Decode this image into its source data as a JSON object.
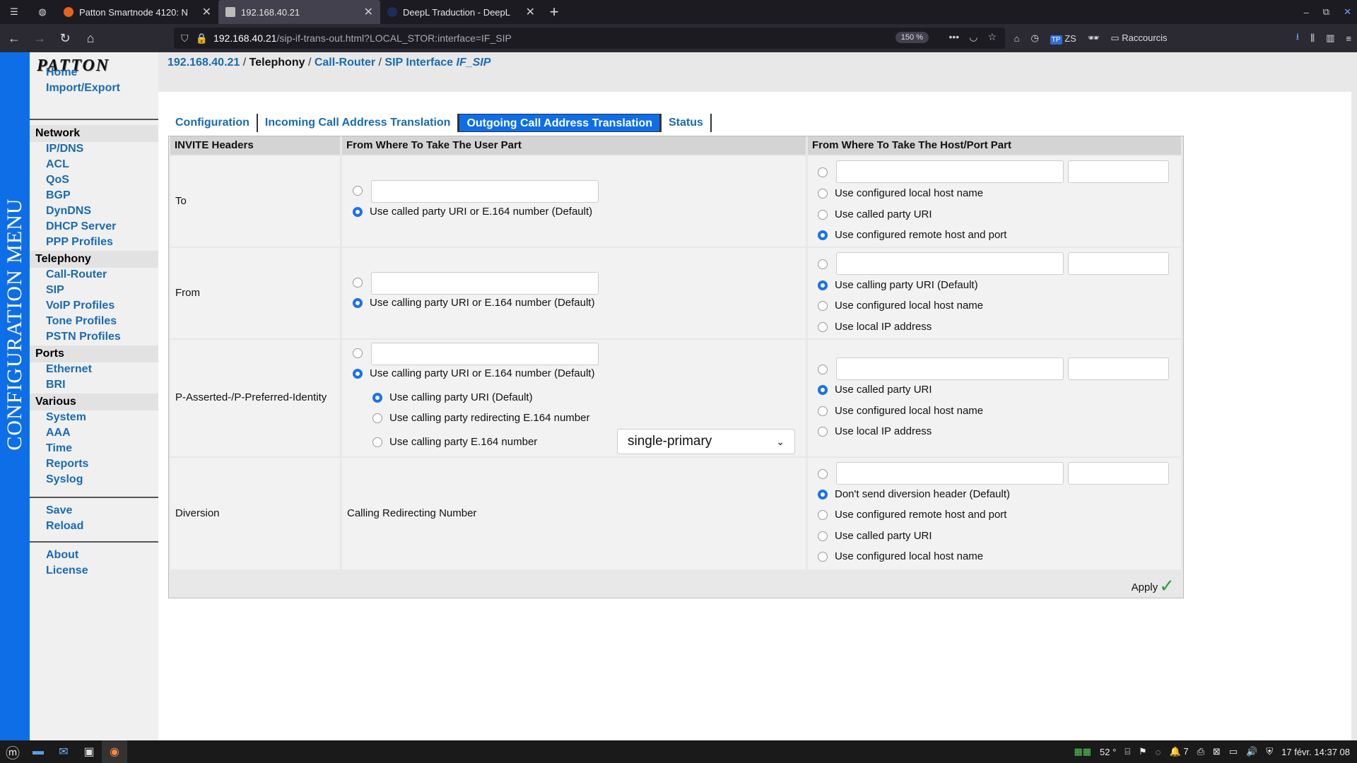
{
  "browser": {
    "tabs": [
      {
        "label": "Patton Smartnode 4120: N",
        "fav_color": "#e8641c"
      },
      {
        "label": "192.168.40.21",
        "fav_color": "#bbbbbb"
      },
      {
        "label": "DeepL Traduction - DeepL",
        "fav_color": "#1b2e5a"
      }
    ],
    "url_host": "192.168.40.21",
    "url_path": "/sip-if-trans-out.html?LOCAL_STOR:interface=IF_SIP",
    "zoom": "150 %",
    "toolbar_profile": "ZS",
    "bookmarks_label": "Raccourcis"
  },
  "side_banner": "CONFIGURATION MENU",
  "logo": "PATTON",
  "menu": {
    "top": [
      "Home",
      "Import/Export"
    ],
    "network_header": "Network",
    "network": [
      "IP/DNS",
      "ACL",
      "QoS",
      "BGP",
      "DynDNS",
      "DHCP Server",
      "PPP Profiles"
    ],
    "telephony_header": "Telephony",
    "telephony": [
      "Call-Router",
      "SIP",
      "VoIP Profiles",
      "Tone Profiles",
      "PSTN Profiles"
    ],
    "ports_header": "Ports",
    "ports": [
      "Ethernet",
      "BRI"
    ],
    "various_header": "Various",
    "various": [
      "System",
      "AAA",
      "Time",
      "Reports",
      "Syslog"
    ],
    "actions": [
      "Save",
      "Reload"
    ],
    "info": [
      "About",
      "License"
    ]
  },
  "breadcrumb": {
    "host": "192.168.40.21",
    "sep1": " / ",
    "section": "Telephony",
    "sep2": " / ",
    "router": "Call-Router",
    "sep3": " / ",
    "iface_prefix": "SIP Interface ",
    "iface": "IF_SIP"
  },
  "tabs": [
    "Configuration",
    "Incoming Call Address Translation",
    "Outgoing Call Address Translation",
    "Status"
  ],
  "active_tab": "Outgoing Call Address Translation",
  "table": {
    "headers": [
      "INVITE Headers",
      "From Where To Take The User Part",
      "From Where To Take The Host/Port Part"
    ],
    "rows": {
      "to": {
        "label": "To",
        "user_option": "Use called party URI or E.164 number (Default)",
        "host_options": [
          "Use configured local host name",
          "Use called party URI",
          "Use configured remote host and port"
        ]
      },
      "from": {
        "label": "From",
        "user_option": "Use calling party URI or E.164 number (Default)",
        "host_options": [
          "Use calling party URI (Default)",
          "Use configured local host name",
          "Use local IP address"
        ]
      },
      "pai": {
        "label": "P-Asserted-/P-Preferred-Identity",
        "user_option": "Use calling party URI or E.164 number (Default)",
        "sub_options": [
          "Use calling party URI (Default)",
          "Use calling party redirecting E.164 number",
          "Use calling party E.164 number"
        ],
        "select_value": "single-primary",
        "host_options": [
          "Use called party URI",
          "Use configured local host name",
          "Use local IP address"
        ]
      },
      "diversion": {
        "label": "Diversion",
        "user_text": "Calling Redirecting Number",
        "host_options": [
          "Don't send diversion header (Default)",
          "Use configured remote host and port",
          "Use called party URI",
          "Use configured local host name"
        ]
      }
    },
    "apply_label": "Apply"
  },
  "taskbar": {
    "temp": "52 °",
    "notif_count": "7",
    "clock": "17 févr. 14:37 08"
  }
}
